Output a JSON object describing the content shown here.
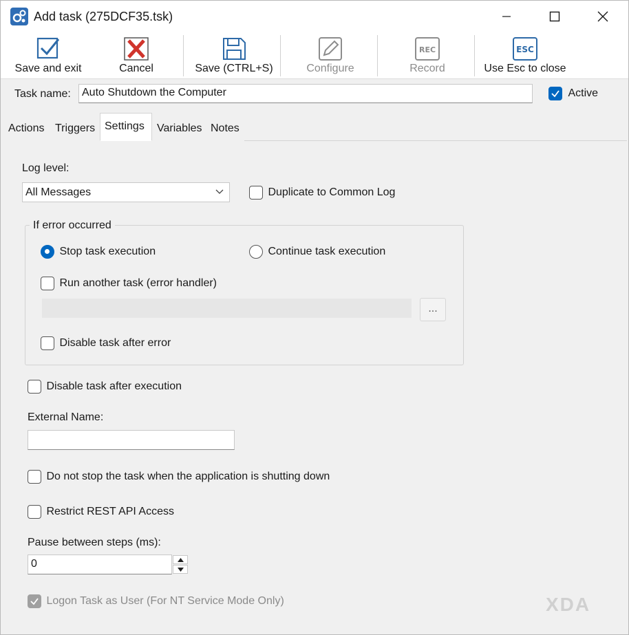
{
  "window": {
    "title": "Add task (275DCF35.tsk)"
  },
  "toolbar": {
    "save_exit": "Save and exit",
    "cancel": "Cancel",
    "save": "Save (CTRL+S)",
    "configure": "Configure",
    "record": "Record",
    "esc_close": "Use Esc to close"
  },
  "task": {
    "name_label": "Task name:",
    "name_value": "Auto Shutdown the Computer",
    "active_label": "Active",
    "active_checked": true
  },
  "tabs": [
    "Actions",
    "Triggers",
    "Settings",
    "Variables",
    "Notes"
  ],
  "active_tab": "Settings",
  "settings": {
    "log_level_label": "Log level:",
    "log_level_value": "All Messages",
    "duplicate_label": "Duplicate to Common Log",
    "error_group_title": "If error occurred",
    "stop_task_label": "Stop task execution",
    "continue_task_label": "Continue task execution",
    "run_another_label": "Run another task (error handler)",
    "ellipsis_label": "...",
    "disable_after_error_label": "Disable task after error",
    "disable_after_exec_label": "Disable task after execution",
    "external_name_label": "External Name:",
    "external_name_value": "",
    "do_not_stop_label": "Do not stop the task when the application is shutting down",
    "restrict_rest_label": "Restrict REST API Access",
    "pause_label": "Pause between steps (ms):",
    "pause_value": "0",
    "logon_label": "Logon Task as User (For NT Service Mode Only)"
  },
  "watermark": "XDA"
}
